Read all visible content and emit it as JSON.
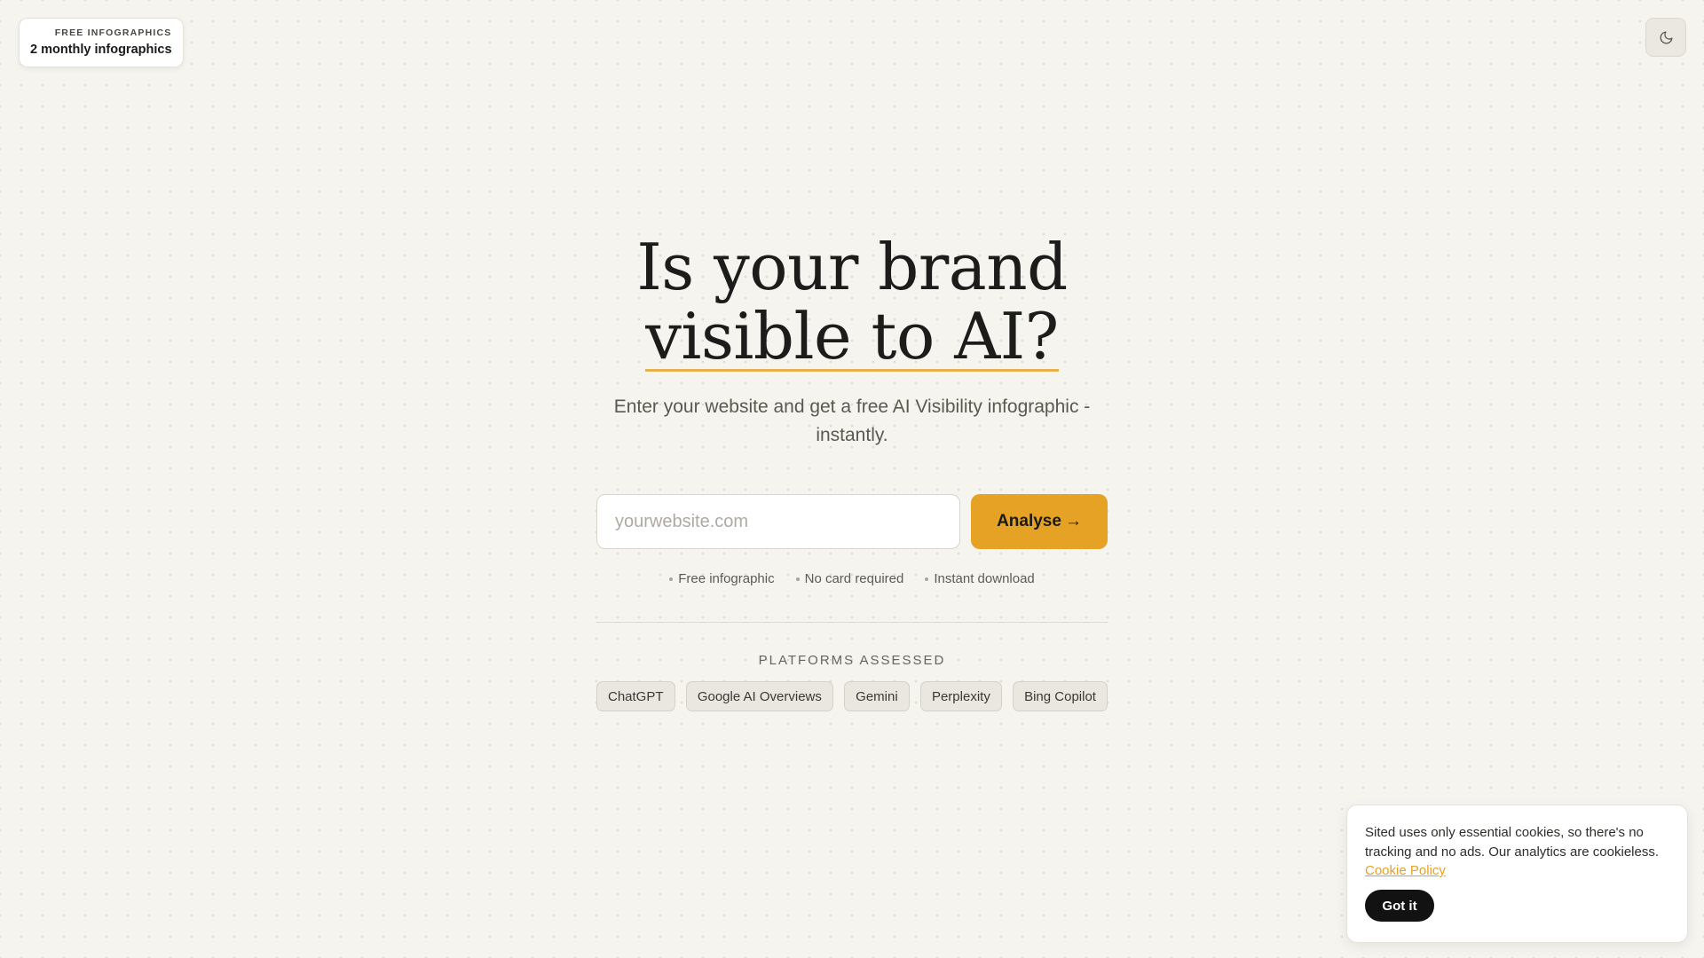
{
  "badge": {
    "kicker": "FREE INFOGRAPHICS",
    "count": "2 monthly infographics"
  },
  "theme_toggle": {
    "icon": "moon-icon"
  },
  "hero": {
    "headline_line1": "Is your brand",
    "headline_line2": "visible to AI?",
    "subhead": "Enter your website and get a free AI Visibility infographic - instantly."
  },
  "form": {
    "placeholder": "yourwebsite.com",
    "value": "",
    "button_label": "Analyse",
    "button_arrow": "→"
  },
  "perks": [
    "Free infographic",
    "No card required",
    "Instant download"
  ],
  "platforms": {
    "title": "PLATFORMS ASSESSED",
    "items": [
      "ChatGPT",
      "Google AI Overviews",
      "Gemini",
      "Perplexity",
      "Bing Copilot"
    ]
  },
  "cookie": {
    "message": "Sited uses only essential cookies, so there's no tracking and no ads. Our analytics are cookieless.",
    "link_label": "Cookie Policy",
    "button_label": "Got it"
  },
  "colors": {
    "accent": "#e5a224",
    "background": "#f6f4ef",
    "dark_button": "#121212"
  }
}
